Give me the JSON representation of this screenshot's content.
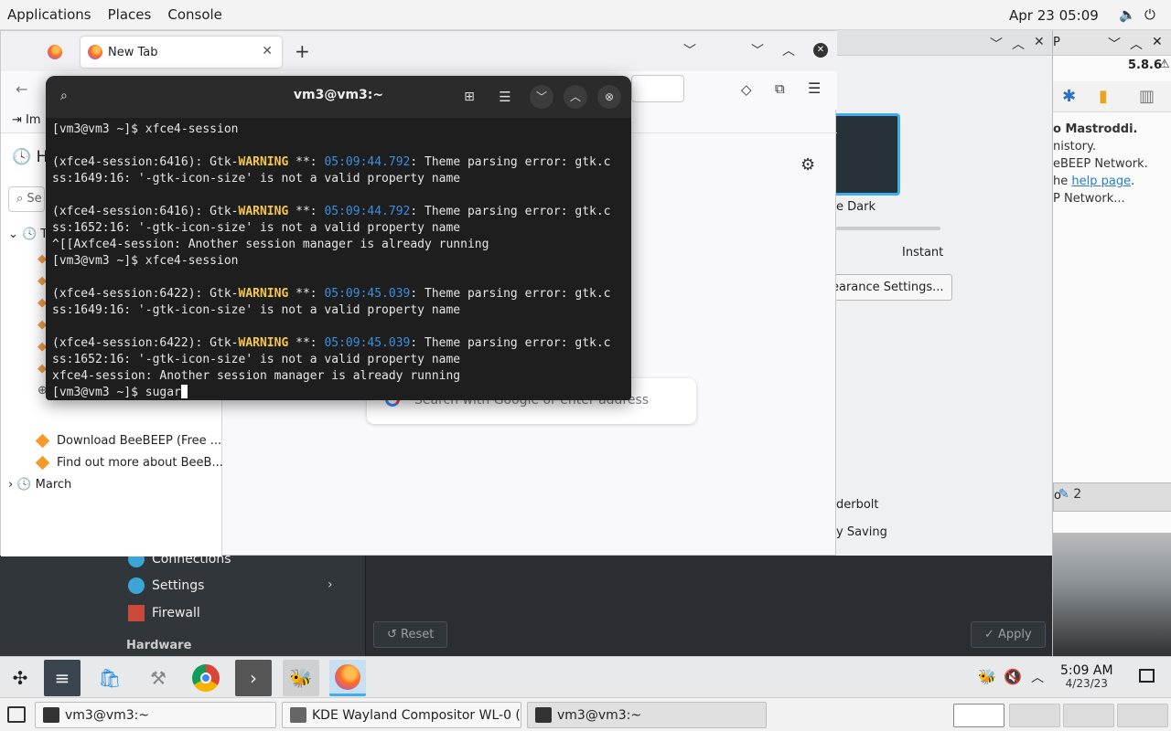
{
  "topbar": {
    "menus": [
      "Applications",
      "Places",
      "Console"
    ],
    "datetime": "Apr 23  05:09"
  },
  "firefox": {
    "tab_label": "New Tab",
    "sidebar_header": "H",
    "sidebar_search": "Se",
    "bookmark_import": "Im",
    "history": {
      "top_group": "T",
      "items": [
        "Download BeeBEEP (Free ...",
        "Find out more about BeeB..."
      ],
      "group_march": "March"
    },
    "search_placeholder": "Search with Google or enter address"
  },
  "terminal": {
    "title": "vm3@vm3:~",
    "lines": [
      {
        "parts": [
          {
            "t": "[vm3@vm3 ~]$ xfce4-session"
          }
        ]
      },
      {
        "parts": [
          {
            "t": ""
          }
        ]
      },
      {
        "parts": [
          {
            "t": "(xfce4-session:6416): Gtk-"
          },
          {
            "t": "WARNING",
            "c": "warn"
          },
          {
            "t": " **: "
          },
          {
            "t": "05:09:44.792",
            "c": "ts"
          },
          {
            "t": ": Theme parsing error: gtk.c"
          }
        ]
      },
      {
        "parts": [
          {
            "t": "ss:1649:16: '-gtk-icon-size' is not a valid property name"
          }
        ]
      },
      {
        "parts": [
          {
            "t": ""
          }
        ]
      },
      {
        "parts": [
          {
            "t": "(xfce4-session:6416): Gtk-"
          },
          {
            "t": "WARNING",
            "c": "warn"
          },
          {
            "t": " **: "
          },
          {
            "t": "05:09:44.792",
            "c": "ts"
          },
          {
            "t": ": Theme parsing error: gtk.c"
          }
        ]
      },
      {
        "parts": [
          {
            "t": "ss:1652:16: '-gtk-icon-size' is not a valid property name"
          }
        ]
      },
      {
        "parts": [
          {
            "t": "^[[Axfce4-session: Another session manager is already running"
          }
        ]
      },
      {
        "parts": [
          {
            "t": "[vm3@vm3 ~]$ xfce4-session"
          }
        ]
      },
      {
        "parts": [
          {
            "t": ""
          }
        ]
      },
      {
        "parts": [
          {
            "t": "(xfce4-session:6422): Gtk-"
          },
          {
            "t": "WARNING",
            "c": "warn"
          },
          {
            "t": " **: "
          },
          {
            "t": "05:09:45.039",
            "c": "ts"
          },
          {
            "t": ": Theme parsing error: gtk.c"
          }
        ]
      },
      {
        "parts": [
          {
            "t": "ss:1649:16: '-gtk-icon-size' is not a valid property name"
          }
        ]
      },
      {
        "parts": [
          {
            "t": ""
          }
        ]
      },
      {
        "parts": [
          {
            "t": "(xfce4-session:6422): Gtk-"
          },
          {
            "t": "WARNING",
            "c": "warn"
          },
          {
            "t": " **: "
          },
          {
            "t": "05:09:45.039",
            "c": "ts"
          },
          {
            "t": ": Theme parsing error: gtk.c"
          }
        ]
      },
      {
        "parts": [
          {
            "t": "ss:1652:16: '-gtk-icon-size' is not a valid property name"
          }
        ]
      },
      {
        "parts": [
          {
            "t": "xfce4-session: Another session manager is already running"
          }
        ]
      },
      {
        "parts": [
          {
            "t": "[vm3@vm3 ~]$ sugar"
          }
        ],
        "cursor": true
      }
    ]
  },
  "kde_right": {
    "theme_name": "e Dark",
    "speed_label": "Instant",
    "appearance_button": "earance Settings...",
    "opt1": "derbolt",
    "opt2": "y Saving",
    "apply_label": "Apply"
  },
  "beebeep": {
    "title_fragment": "P",
    "version": "5.8.6",
    "line1": "o Mastroddi.",
    "line2": "nistory.",
    "line3": "eBEEP Network.",
    "line4_pre": "he ",
    "line4_link": "help page",
    "line4_post": ".",
    "line5": "P Network...",
    "bar_text": "o",
    "count": "2"
  },
  "kde_settings": {
    "items": [
      "Connections",
      "Settings",
      "Firewall"
    ],
    "category": "Hardware",
    "reset_label": "Reset"
  },
  "taskbar": {
    "time": "5:09 AM",
    "date": "4/23/23"
  },
  "window_list": [
    "vm3@vm3:~",
    "KDE Wayland Compositor WL-0 (w...",
    "vm3@vm3:~"
  ],
  "colors": {
    "accent": "#3daee9",
    "warning": "#f7c843",
    "timestamp": "#3a8fde"
  }
}
